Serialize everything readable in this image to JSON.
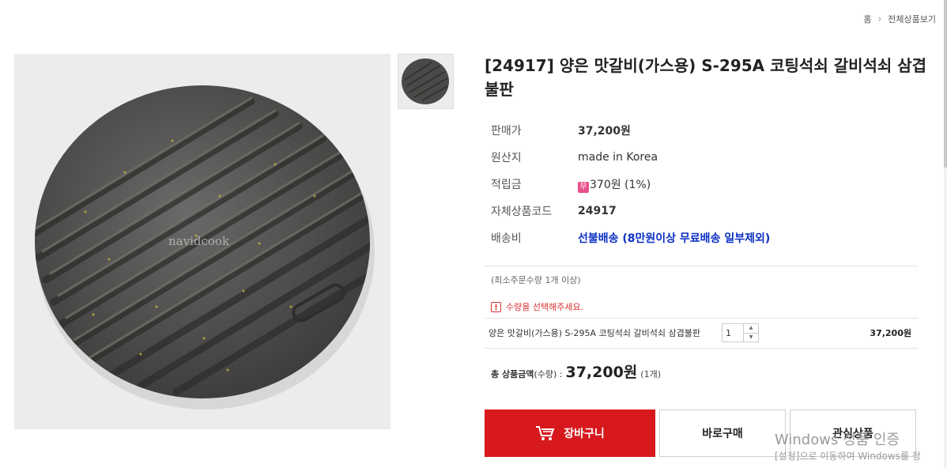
{
  "breadcrumb": {
    "home": "홈",
    "current": "전체상품보기"
  },
  "product": {
    "title": "[24917] 양은 맛갈비(가스용) S-295A 코팅석쇠 갈비석쇠 삼겹불판",
    "image_watermark": "navidcook",
    "info": {
      "price_label": "판매가",
      "price_value": "37,200원",
      "origin_label": "원산지",
      "origin_value": "made in Korea",
      "points_label": "적립금",
      "points_badge": "무",
      "points_value": "370원 (1%)",
      "code_label": "자체상품코드",
      "code_value": "24917",
      "shipping_label": "배송비",
      "shipping_value": "선불배송 (8만원이상 무료배송 일부제외)"
    }
  },
  "order": {
    "min_order": "(최소주문수량 1개 이상)",
    "warning_icon": "!",
    "warning_text": "수량을 선택해주세요.",
    "option_name": "양은 맛갈비(가스용) S-295A 코팅석쇠 갈비석쇠 삼겹불판",
    "quantity": "1",
    "qty_up": "▲",
    "qty_down": "▼",
    "option_price": "37,200원",
    "total_label": "총 상품금액",
    "total_label_sub": "(수량) :",
    "total_price": "37,200원",
    "total_count": "(1개)"
  },
  "buttons": {
    "cart": "장바구니",
    "buy": "바로구매",
    "wish": "관심상품"
  },
  "watermark": {
    "line1": "Windows 정품 인증",
    "line2": "[설정]으로 이동하여 Windows를 정"
  },
  "colors": {
    "primary_red": "#d7191e",
    "link_blue": "#0a2fc4",
    "warning_red": "#d9302f",
    "badge_pink": "#e8508a"
  }
}
